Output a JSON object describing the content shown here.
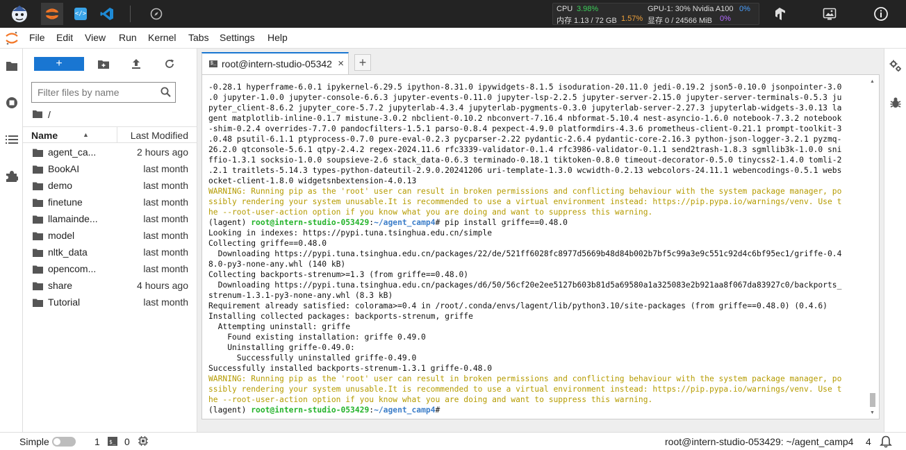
{
  "topbar": {
    "resources": {
      "cpu_label": "CPU",
      "cpu_value": "3.98%",
      "mem_label": "内存 1.13 / 72 GB",
      "mem_value": "1.57%",
      "gpu_label": "GPU-1: 30% Nvidia A100",
      "gpu_value": "0%",
      "vram_label": "显存 0 / 24566 MiB",
      "vram_value": "0%"
    }
  },
  "menubar": {
    "items": [
      "File",
      "Edit",
      "View",
      "Run",
      "Kernel",
      "Tabs",
      "Settings",
      "Help"
    ]
  },
  "filebrowser": {
    "new_label": "+",
    "filter_placeholder": "Filter files by name",
    "breadcrumb": "/",
    "header_name": "Name",
    "header_modified": "Last Modified",
    "files": [
      {
        "name": "agent_ca...",
        "modified": "2 hours ago"
      },
      {
        "name": "BookAI",
        "modified": "last month"
      },
      {
        "name": "demo",
        "modified": "last month"
      },
      {
        "name": "finetune",
        "modified": "last month"
      },
      {
        "name": "llamainde...",
        "modified": "last month"
      },
      {
        "name": "model",
        "modified": "last month"
      },
      {
        "name": "nltk_data",
        "modified": "last month"
      },
      {
        "name": "opencom...",
        "modified": "last month"
      },
      {
        "name": "share",
        "modified": "4 hours ago"
      },
      {
        "name": "Tutorial",
        "modified": "last month"
      }
    ]
  },
  "tabs": {
    "active_label": "root@intern-studio-05342",
    "close_symbol": "×",
    "add_symbol": "+"
  },
  "terminal": {
    "lines": [
      {
        "type": "normal",
        "text": "-0.28.1 hyperframe-6.0.1 ipykernel-6.29.5 ipython-8.31.0 ipywidgets-8.1.5 isoduration-20.11.0 jedi-0.19.2 json5-0.10.0 jsonpointer-3.0"
      },
      {
        "type": "normal",
        "text": ".0 jupyter-1.0.0 jupyter-console-6.6.3 jupyter-events-0.11.0 jupyter-lsp-2.2.5 jupyter-server-2.15.0 jupyter-server-terminals-0.5.3 ju"
      },
      {
        "type": "normal",
        "text": "pyter_client-8.6.2 jupyter_core-5.7.2 jupyterlab-4.3.4 jupyterlab-pygments-0.3.0 jupyterlab-server-2.27.3 jupyterlab-widgets-3.0.13 la"
      },
      {
        "type": "normal",
        "text": "gent matplotlib-inline-0.1.7 mistune-3.0.2 nbclient-0.10.2 nbconvert-7.16.4 nbformat-5.10.4 nest-asyncio-1.6.0 notebook-7.3.2 notebook"
      },
      {
        "type": "normal",
        "text": "-shim-0.2.4 overrides-7.7.0 pandocfilters-1.5.1 parso-0.8.4 pexpect-4.9.0 platformdirs-4.3.6 prometheus-client-0.21.1 prompt-toolkit-3"
      },
      {
        "type": "normal",
        "text": ".0.48 psutil-6.1.1 ptyprocess-0.7.0 pure-eval-0.2.3 pycparser-2.22 pydantic-2.6.4 pydantic-core-2.16.3 python-json-logger-3.2.1 pyzmq-"
      },
      {
        "type": "normal",
        "text": "26.2.0 qtconsole-5.6.1 qtpy-2.4.2 regex-2024.11.6 rfc3339-validator-0.1.4 rfc3986-validator-0.1.1 send2trash-1.8.3 sgmllib3k-1.0.0 sni"
      },
      {
        "type": "normal",
        "text": "ffio-1.3.1 socksio-1.0.0 soupsieve-2.6 stack_data-0.6.3 terminado-0.18.1 tiktoken-0.8.0 timeout-decorator-0.5.0 tinycss2-1.4.0 tomli-2"
      },
      {
        "type": "normal",
        "text": ".2.1 traitlets-5.14.3 types-python-dateutil-2.9.0.20241206 uri-template-1.3.0 wcwidth-0.2.13 webcolors-24.11.1 webencodings-0.5.1 webs"
      },
      {
        "type": "normal",
        "text": "ocket-client-1.8.0 widgetsnbextension-4.0.13"
      },
      {
        "type": "warn",
        "text": "WARNING: Running pip as the 'root' user can result in broken permissions and conflicting behaviour with the system package manager, po"
      },
      {
        "type": "warn",
        "text": "ssibly rendering your system unusable.It is recommended to use a virtual environment instead: https://pip.pypa.io/warnings/venv. Use t"
      },
      {
        "type": "warn",
        "text": "he --root-user-action option if you know what you are doing and want to suppress this warning."
      },
      {
        "type": "prompt",
        "env": "(lagent) ",
        "host": "root@intern-studio-053429",
        "colon": ":",
        "path": "~/agent_camp4",
        "cmd": "# pip install griffe==0.48.0"
      },
      {
        "type": "normal",
        "text": "Looking in indexes: https://pypi.tuna.tsinghua.edu.cn/simple"
      },
      {
        "type": "normal",
        "text": "Collecting griffe==0.48.0"
      },
      {
        "type": "normal",
        "text": "  Downloading https://pypi.tuna.tsinghua.edu.cn/packages/22/de/521ff6028fc8977d5669b48d84b002b7bf5c99a3e9c551c92d4c6bf95ec1/griffe-0.4"
      },
      {
        "type": "normal",
        "text": "8.0-py3-none-any.whl (140 kB)"
      },
      {
        "type": "normal",
        "text": "Collecting backports-strenum>=1.3 (from griffe==0.48.0)"
      },
      {
        "type": "normal",
        "text": "  Downloading https://pypi.tuna.tsinghua.edu.cn/packages/d6/50/56cf20e2ee5127b603b81d5a69580a1a325083e2b921aa8f067da83927c0/backports_"
      },
      {
        "type": "normal",
        "text": "strenum-1.3.1-py3-none-any.whl (8.3 kB)"
      },
      {
        "type": "normal",
        "text": "Requirement already satisfied: colorama>=0.4 in /root/.conda/envs/lagent/lib/python3.10/site-packages (from griffe==0.48.0) (0.4.6)"
      },
      {
        "type": "normal",
        "text": "Installing collected packages: backports-strenum, griffe"
      },
      {
        "type": "normal",
        "text": "  Attempting uninstall: griffe"
      },
      {
        "type": "normal",
        "text": "    Found existing installation: griffe 0.49.0"
      },
      {
        "type": "normal",
        "text": "    Uninstalling griffe-0.49.0:"
      },
      {
        "type": "normal",
        "text": "      Successfully uninstalled griffe-0.49.0"
      },
      {
        "type": "normal",
        "text": "Successfully installed backports-strenum-1.3.1 griffe-0.48.0"
      },
      {
        "type": "warn",
        "text": "WARNING: Running pip as the 'root' user can result in broken permissions and conflicting behaviour with the system package manager, po"
      },
      {
        "type": "warn",
        "text": "ssibly rendering your system unusable.It is recommended to use a virtual environment instead: https://pip.pypa.io/warnings/venv. Use t"
      },
      {
        "type": "warn",
        "text": "he --root-user-action option if you know what you are doing and want to suppress this warning."
      },
      {
        "type": "prompt",
        "env": "(lagent) ",
        "host": "root@intern-studio-053429",
        "colon": ":",
        "path": "~/agent_camp4",
        "cmd": "#"
      }
    ]
  },
  "statusbar": {
    "mode_label": "Simple",
    "kernels_count": "1",
    "terminals_count": "0",
    "terminal_path": "root@intern-studio-053429: ~/agent_camp4",
    "notifications_count": "4"
  }
}
